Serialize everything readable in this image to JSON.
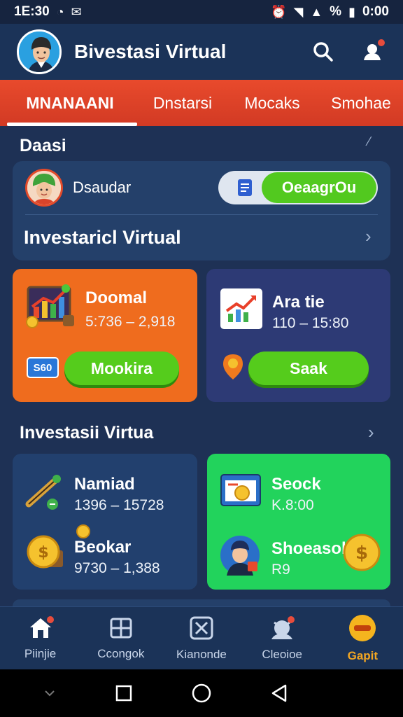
{
  "status_bar": {
    "time": "1E:30",
    "clock_right": "0:00",
    "battery_label": "%"
  },
  "header": {
    "title": "Bivestasi Virtual",
    "avatar_icon": "profile-avatar",
    "search_icon": "search-icon",
    "notification_icon": "notification-icon"
  },
  "tabs": [
    {
      "label": "MNANAANI",
      "active": true
    },
    {
      "label": "Dnstarsi",
      "active": false
    },
    {
      "label": "Mocaks",
      "active": false
    },
    {
      "label": "Smohae",
      "active": false
    }
  ],
  "section1": {
    "heading": "Daasi"
  },
  "panel": {
    "user_name": "Dsaudar",
    "toggle_label": "OeaagrOu",
    "title": "Investaricl Virtual"
  },
  "card_orange": {
    "title": "Doomal",
    "range": "5:736 – 2,918",
    "badge": "S60",
    "button": "Mookira",
    "color": "#ef6c1e"
  },
  "card_navy": {
    "title": "Ara tie",
    "range": "110 – 15:80",
    "button": "Saak",
    "color": "#2d3a75"
  },
  "section2": {
    "heading": "Investasii Virtua"
  },
  "card_blue": {
    "item1_title": "Namiad",
    "item1_range": "1396 – 15728",
    "item2_title": "Beokar",
    "item2_range": "9730 – 1,388",
    "color": "#22406e"
  },
  "card_green": {
    "item1_title": "Seock",
    "item1_value": "K.8:00",
    "item2_title": "Shoeasol",
    "item2_value": "R9",
    "color": "#22d35c"
  },
  "bottom_nav": [
    {
      "label": "Piinjie",
      "icon": "home-icon",
      "active": false,
      "dot": true
    },
    {
      "label": "Ccongok",
      "icon": "grid-icon",
      "active": false,
      "dot": false
    },
    {
      "label": "Kianonde",
      "icon": "chart-box-icon",
      "active": false,
      "dot": false
    },
    {
      "label": "Cleoioe",
      "icon": "robot-icon",
      "active": false,
      "dot": true
    },
    {
      "label": "Gapit",
      "icon": "gold-icon",
      "active": true,
      "dot": false
    }
  ]
}
